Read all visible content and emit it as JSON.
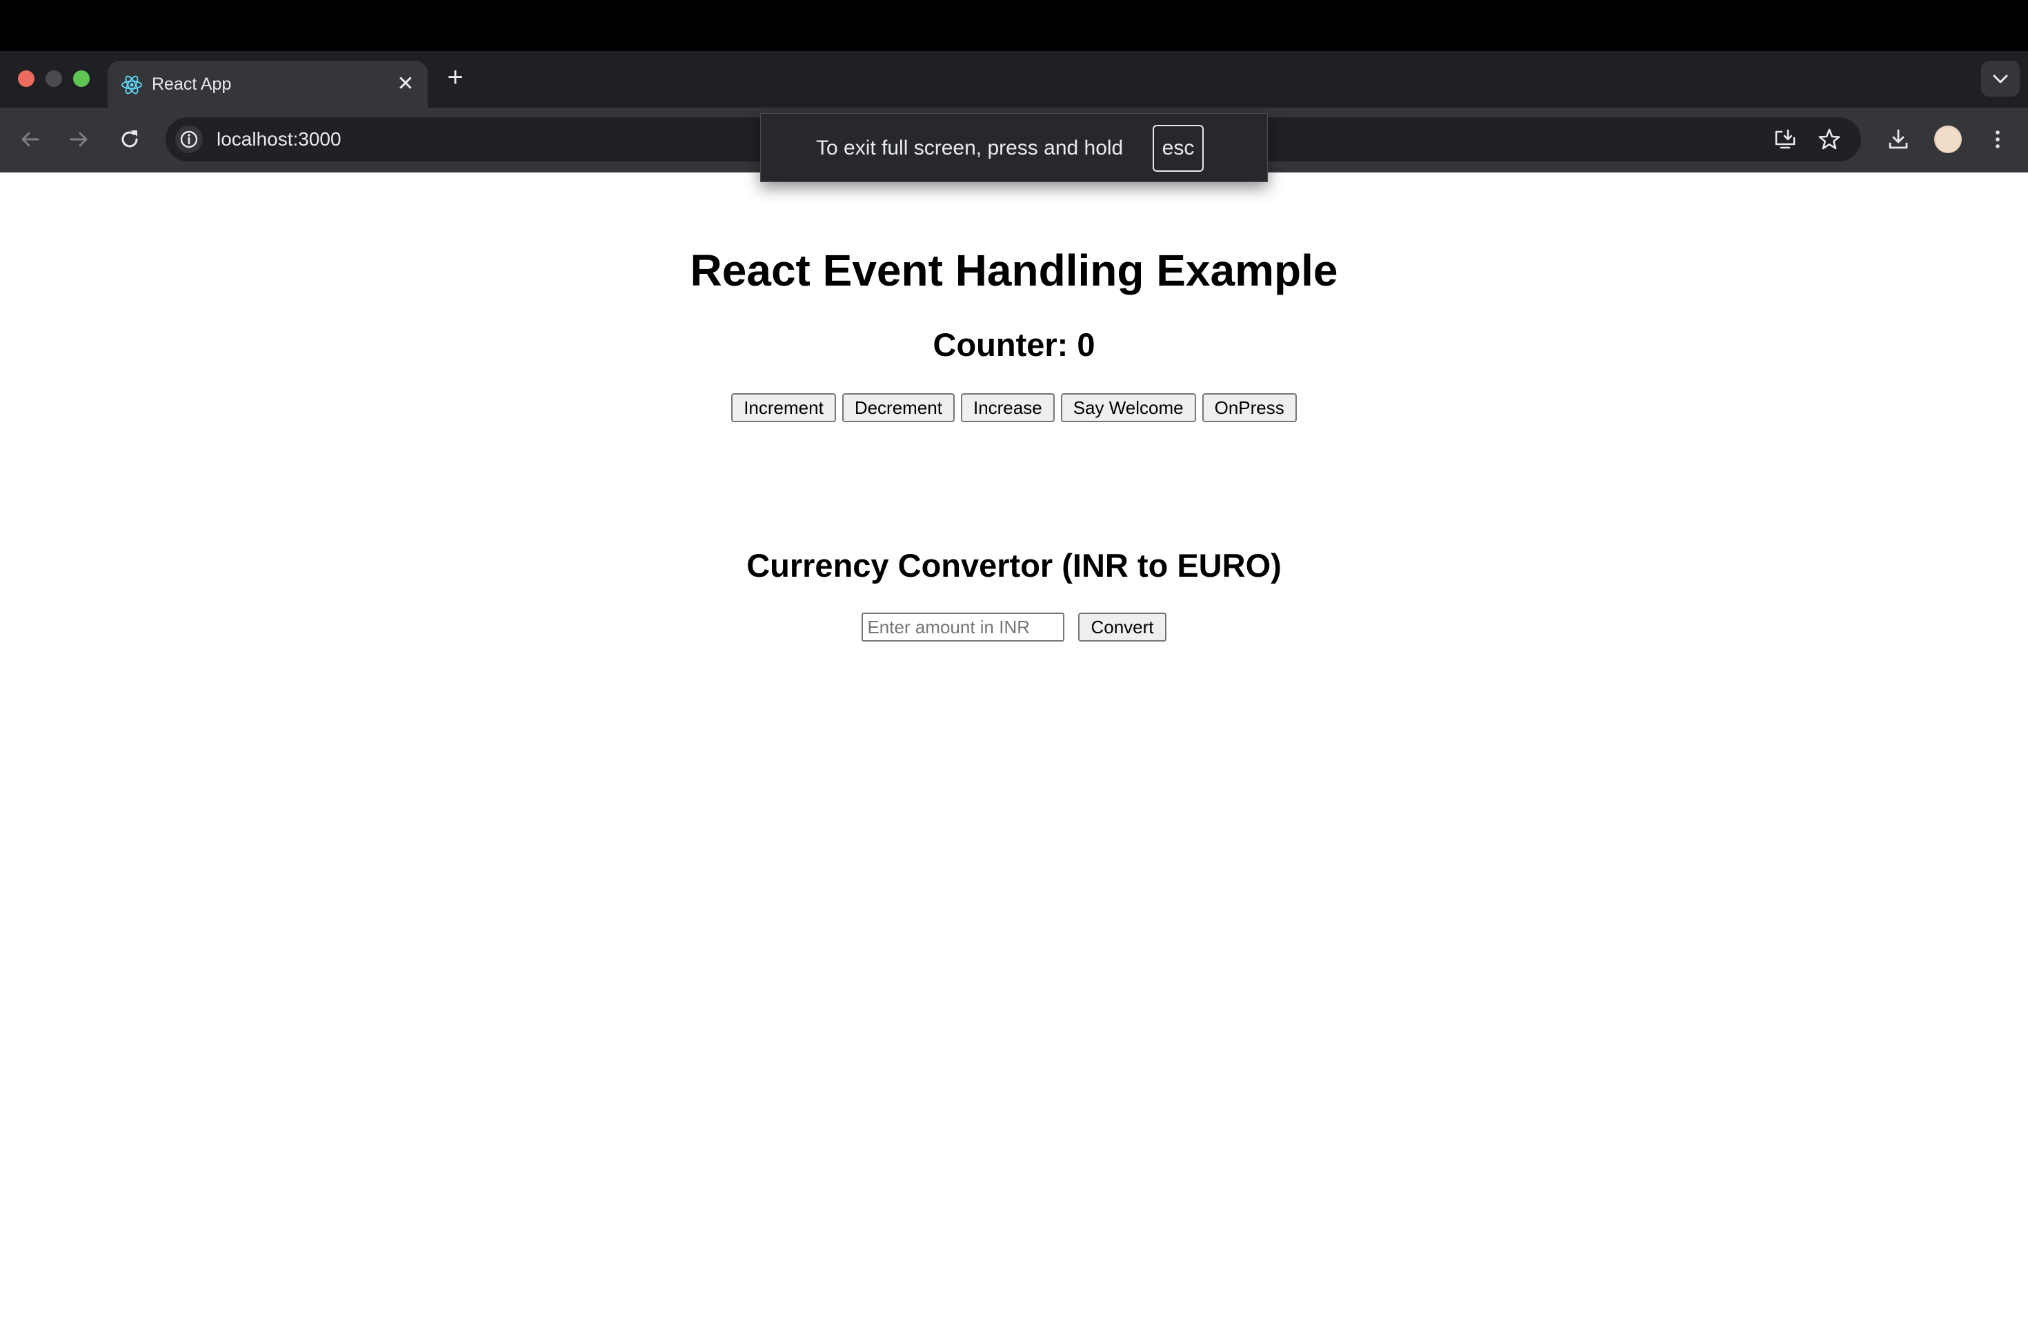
{
  "browser": {
    "tab": {
      "title": "React App",
      "close_glyph": "✕",
      "favicon": "react-logo-icon"
    },
    "new_tab_glyph": "+",
    "address": {
      "url": "localhost:3000"
    },
    "fullscreen_notice": {
      "text": "To exit full screen, press and hold",
      "key": "esc"
    },
    "icons": [
      "back-arrow-icon",
      "forward-arrow-icon",
      "reload-icon",
      "site-info-icon",
      "install-app-icon",
      "bookmark-star-icon",
      "download-icon",
      "profile-avatar-icon",
      "more-menu-icon",
      "tab-search-chevron-icon"
    ]
  },
  "page": {
    "title": "React Event Handling Example",
    "counter_label": "Counter: 0",
    "buttons": [
      {
        "label": "Increment"
      },
      {
        "label": "Decrement"
      },
      {
        "label": "Increase"
      },
      {
        "label": "Say Welcome"
      },
      {
        "label": "OnPress"
      }
    ],
    "converter": {
      "title": "Currency Convertor (INR to EURO)",
      "input_value": "",
      "input_placeholder": "Enter amount in INR",
      "button_label": "Convert"
    }
  },
  "colors": {
    "chrome_dark": "#1f2023",
    "toolbar": "#35363a",
    "omnibox": "#202124",
    "text_light": "#e8eaed"
  }
}
